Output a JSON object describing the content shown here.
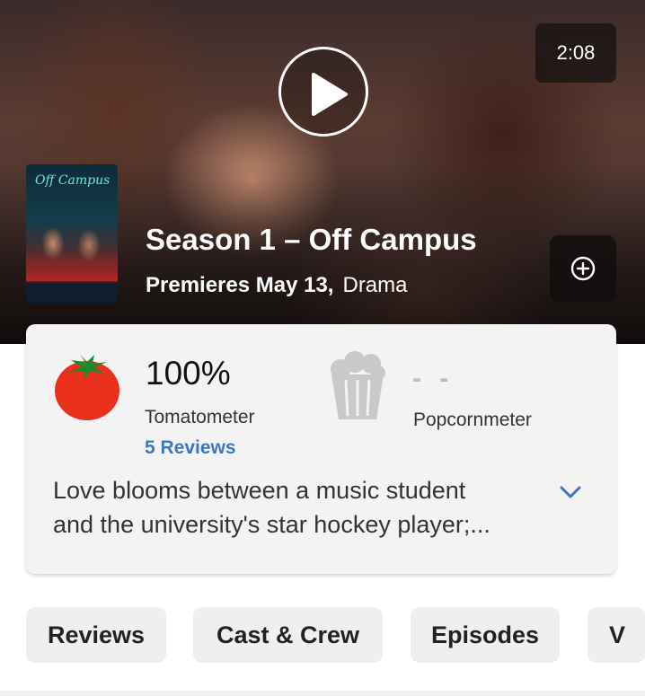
{
  "hero": {
    "duration": "2:08",
    "poster": {
      "title_art": "Off Campus"
    },
    "title": "Season 1 – Off Campus",
    "premiere": "Premieres May 13,",
    "genre": "Drama"
  },
  "scores": {
    "tomatometer": {
      "value": "100%",
      "label": "Tomatometer",
      "reviews_link": "5 Reviews"
    },
    "popcornmeter": {
      "value": "- -",
      "label": "Popcornmeter"
    }
  },
  "synopsis": {
    "line1": "Love blooms between a music student",
    "line2": "and the university's star hockey player;..."
  },
  "tabs": [
    {
      "label": "Reviews"
    },
    {
      "label": "Cast & Crew"
    },
    {
      "label": "Episodes"
    },
    {
      "label": "V"
    }
  ],
  "colors": {
    "accent_link": "#3a78c4",
    "tomato_red": "#e8301c",
    "card_bg": "#f3f3f3"
  },
  "icons": [
    "play-icon",
    "plus-circle-icon",
    "tomato-icon",
    "popcorn-icon",
    "chevron-down-icon"
  ]
}
